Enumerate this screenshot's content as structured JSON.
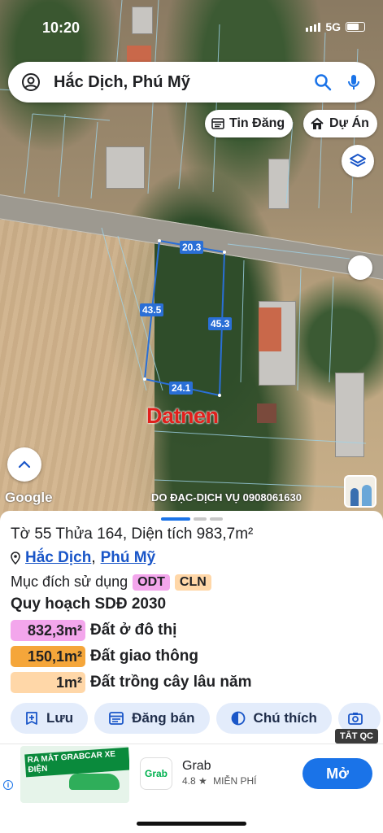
{
  "status_bar": {
    "time": "10:20",
    "network": "5G"
  },
  "search": {
    "query": "Hắc Dịch, Phú Mỹ"
  },
  "chips": {
    "listing_label": "Tin Đăng",
    "project_label": "Dự Án"
  },
  "parcel": {
    "dimensions": {
      "top": "20.3",
      "left": "43.5",
      "right": "45.3",
      "bottom": "24.1"
    },
    "watermark": "Datnen"
  },
  "map_footer": {
    "logo": "Google",
    "credit": "DO ĐẠC-DỊCH VỤ 0908061630"
  },
  "sheet": {
    "title": "Tờ 55 Thửa 164, Diện tích 983,7m²",
    "location": {
      "commune": "Hắc Dịch",
      "separator": ",",
      "town": "Phú Mỹ"
    },
    "purpose_label": "Mục đích sử dụng",
    "purpose_tags": [
      {
        "code": "ODT",
        "color": "#f3a6ec"
      },
      {
        "code": "CLN",
        "color": "#ffd7a8"
      }
    ],
    "plan_title": "Quy hoạch SDĐ 2030",
    "zones": [
      {
        "area": "832,3m²",
        "name": "Đất ở đô thị",
        "color": "#f3a6ec"
      },
      {
        "area": "150,1m²",
        "name": "Đất giao thông",
        "color": "#f5a63a"
      },
      {
        "area": "1m²",
        "name": "Đất trồng cây lâu năm",
        "color": "#ffd7a8"
      }
    ],
    "actions": {
      "save": "Lưu",
      "post": "Đăng bán",
      "legend": "Chú thích",
      "capture": ""
    }
  },
  "ad": {
    "close_label": "TẮT QC",
    "banner_text": "RA MẮT GRABCAR XE ĐIỆN",
    "logo_text": "Grab",
    "app_name": "Grab",
    "rating": "4.8 ★",
    "price": "MIỄN PHÍ",
    "cta": "Mở"
  }
}
